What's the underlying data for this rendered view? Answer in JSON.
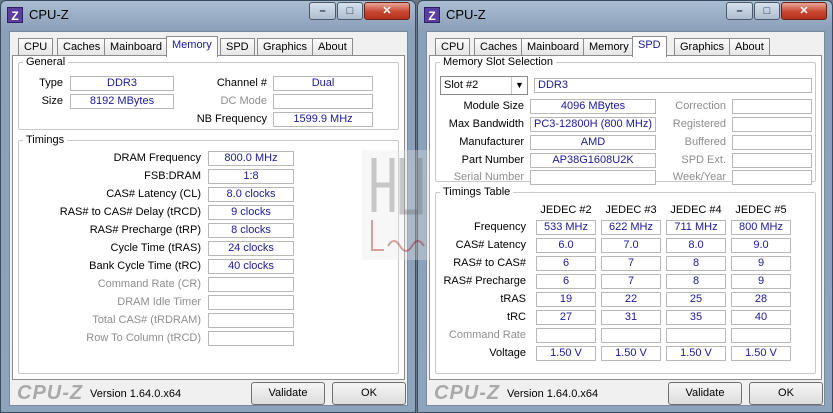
{
  "left_window": {
    "title": "CPU-Z",
    "app_icon_letter": "Z",
    "tabs": [
      {
        "label": "CPU"
      },
      {
        "label": "Caches"
      },
      {
        "label": "Mainboard"
      },
      {
        "label": "Memory",
        "active": true
      },
      {
        "label": "SPD"
      },
      {
        "label": "Graphics"
      },
      {
        "label": "About"
      }
    ],
    "general": {
      "legend": "General",
      "type_label": "Type",
      "type_value": "DDR3",
      "size_label": "Size",
      "size_value": "8192 MBytes",
      "channel_label": "Channel #",
      "channel_value": "Dual",
      "dcmode_label": "DC Mode",
      "dcmode_value": "",
      "nbfreq_label": "NB Frequency",
      "nbfreq_value": "1599.9 MHz"
    },
    "timings": {
      "legend": "Timings",
      "rows": [
        {
          "label": "DRAM Frequency",
          "value": "800.0 MHz",
          "enabled": true
        },
        {
          "label": "FSB:DRAM",
          "value": "1:8",
          "enabled": true
        },
        {
          "label": "CAS# Latency (CL)",
          "value": "8.0 clocks",
          "enabled": true
        },
        {
          "label": "RAS# to CAS# Delay (tRCD)",
          "value": "9 clocks",
          "enabled": true
        },
        {
          "label": "RAS# Precharge (tRP)",
          "value": "8 clocks",
          "enabled": true
        },
        {
          "label": "Cycle Time (tRAS)",
          "value": "24 clocks",
          "enabled": true
        },
        {
          "label": "Bank Cycle Time (tRC)",
          "value": "40 clocks",
          "enabled": true
        },
        {
          "label": "Command Rate (CR)",
          "value": "",
          "enabled": false
        },
        {
          "label": "DRAM Idle Timer",
          "value": "",
          "enabled": false
        },
        {
          "label": "Total CAS# (tRDRAM)",
          "value": "",
          "enabled": false
        },
        {
          "label": "Row To Column (tRCD)",
          "value": "",
          "enabled": false
        }
      ]
    },
    "footer": {
      "brand": "CPU-Z",
      "version": "Version 1.64.0.x64",
      "validate_label": "Validate",
      "ok_label": "OK"
    }
  },
  "right_window": {
    "title": "CPU-Z",
    "app_icon_letter": "Z",
    "tabs": [
      {
        "label": "CPU"
      },
      {
        "label": "Caches"
      },
      {
        "label": "Mainboard"
      },
      {
        "label": "Memory"
      },
      {
        "label": "SPD",
        "active": true
      },
      {
        "label": "Graphics"
      },
      {
        "label": "About"
      }
    ],
    "slot": {
      "legend": "Memory Slot Selection",
      "selected": "Slot #2",
      "type_value": "DDR3",
      "module_size_label": "Module Size",
      "module_size_value": "4096 MBytes",
      "max_bw_label": "Max Bandwidth",
      "max_bw_value": "PC3-12800H (800 MHz)",
      "manufacturer_label": "Manufacturer",
      "manufacturer_value": "AMD",
      "part_label": "Part Number",
      "part_value": "AP38G1608U2K",
      "serial_label": "Serial Number",
      "serial_value": "",
      "correction_label": "Correction",
      "correction_value": "",
      "registered_label": "Registered",
      "registered_value": "",
      "buffered_label": "Buffered",
      "buffered_value": "",
      "spdext_label": "SPD Ext.",
      "spdext_value": "",
      "weekyear_label": "Week/Year",
      "weekyear_value": ""
    },
    "timings_table": {
      "legend": "Timings Table",
      "columns": [
        "JEDEC #2",
        "JEDEC #3",
        "JEDEC #4",
        "JEDEC #5"
      ],
      "rows": [
        {
          "label": "Frequency",
          "enabled": true,
          "values": [
            "533 MHz",
            "622 MHz",
            "711 MHz",
            "800 MHz"
          ]
        },
        {
          "label": "CAS# Latency",
          "enabled": true,
          "values": [
            "6.0",
            "7.0",
            "8.0",
            "9.0"
          ]
        },
        {
          "label": "RAS# to CAS#",
          "enabled": true,
          "values": [
            "6",
            "7",
            "8",
            "9"
          ]
        },
        {
          "label": "RAS# Precharge",
          "enabled": true,
          "values": [
            "6",
            "7",
            "8",
            "9"
          ]
        },
        {
          "label": "tRAS",
          "enabled": true,
          "values": [
            "19",
            "22",
            "25",
            "28"
          ]
        },
        {
          "label": "tRC",
          "enabled": true,
          "values": [
            "27",
            "31",
            "35",
            "40"
          ]
        },
        {
          "label": "Command Rate",
          "enabled": false,
          "values": [
            "",
            "",
            "",
            ""
          ]
        },
        {
          "label": "Voltage",
          "enabled": true,
          "values": [
            "1.50 V",
            "1.50 V",
            "1.50 V",
            "1.50 V"
          ]
        }
      ]
    },
    "footer": {
      "brand": "CPU-Z",
      "version": "Version 1.64.0.x64",
      "validate_label": "Validate",
      "ok_label": "OK"
    }
  },
  "window_buttons": {
    "minimize": "–",
    "maximize": "□",
    "close": "✕"
  },
  "watermark": {
    "text": "HWLegend"
  }
}
